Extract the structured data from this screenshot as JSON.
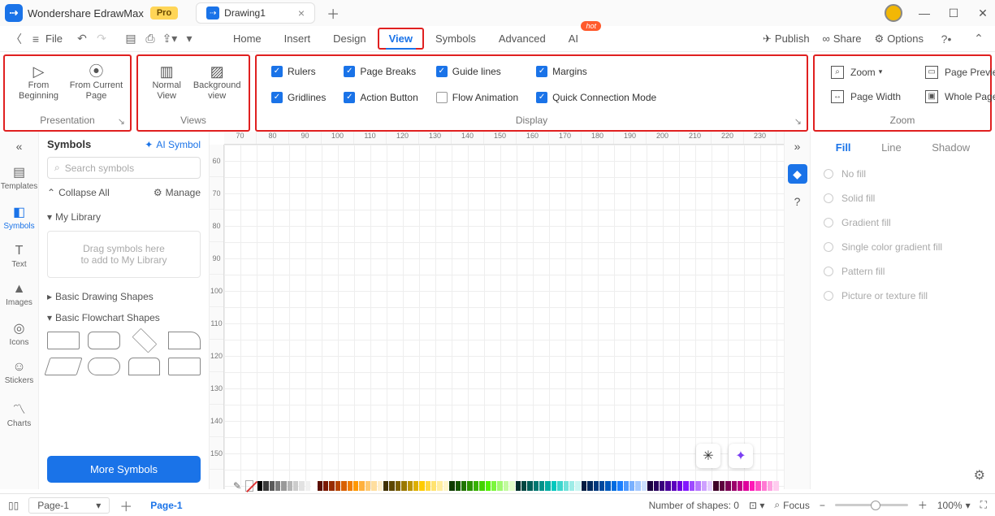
{
  "titlebar": {
    "app_name": "Wondershare EdrawMax",
    "pro": "Pro",
    "tab": "Drawing1"
  },
  "menubar": {
    "file": "File",
    "items": [
      "Home",
      "Insert",
      "Design",
      "View",
      "Symbols",
      "Advanced",
      "AI"
    ],
    "active": "View",
    "hot": "hot",
    "publish": "Publish",
    "share": "Share",
    "options": "Options"
  },
  "ribbon": {
    "presentation": {
      "label": "Presentation",
      "from_beginning": "From\nBeginning",
      "from_current": "From Current\nPage"
    },
    "views": {
      "label": "Views",
      "normal": "Normal\nView",
      "background": "Background\nview"
    },
    "display": {
      "label": "Display",
      "rulers": "Rulers",
      "page_breaks": "Page Breaks",
      "guide_lines": "Guide lines",
      "margins": "Margins",
      "gridlines": "Gridlines",
      "action_button": "Action Button",
      "flow_animation": "Flow Animation",
      "quick_conn": "Quick Connection Mode"
    },
    "zoom": {
      "label": "Zoom",
      "zoom": "Zoom",
      "page_preview": "Page Preview",
      "page_width": "Page Width",
      "whole_page": "Whole Page"
    }
  },
  "leftbar": {
    "templates": "Templates",
    "symbols": "Symbols",
    "text": "Text",
    "images": "Images",
    "icons": "Icons",
    "stickers": "Stickers",
    "charts": "Charts"
  },
  "symbols": {
    "title": "Symbols",
    "ai": "AI Symbol",
    "search_ph": "Search symbols",
    "collapse": "Collapse All",
    "manage": "Manage",
    "mylib": "My Library",
    "drop1": "Drag symbols here",
    "drop2": "to add to My Library",
    "basic_drawing": "Basic Drawing Shapes",
    "basic_flow": "Basic Flowchart Shapes",
    "more": "More Symbols"
  },
  "ruler_h": [
    "70",
    "80",
    "90",
    "100",
    "110",
    "120",
    "130",
    "140",
    "150",
    "160",
    "170",
    "180",
    "190",
    "200",
    "210",
    "220",
    "230"
  ],
  "ruler_v": [
    "60",
    "70",
    "80",
    "90",
    "100",
    "110",
    "120",
    "130",
    "140",
    "150"
  ],
  "rightpanel": {
    "tabs": [
      "Fill",
      "Line",
      "Shadow"
    ],
    "opts": [
      "No fill",
      "Solid fill",
      "Gradient fill",
      "Single color gradient fill",
      "Pattern fill",
      "Picture or texture fill"
    ]
  },
  "colors": [
    "#000",
    "#3b3b3b",
    "#5a5a5a",
    "#7a7a7a",
    "#999",
    "#b5b5b5",
    "#ccc",
    "#e2e2e2",
    "#f0f0f0",
    "#fff",
    "#5b0f00",
    "#7b1700",
    "#972b00",
    "#b84400",
    "#d96000",
    "#f07c00",
    "#ff9800",
    "#ffb13d",
    "#ffc970",
    "#ffde9e",
    "#ffeec9",
    "#403000",
    "#5c4600",
    "#7a5e00",
    "#9a7800",
    "#bb9300",
    "#ddaf00",
    "#ffcb00",
    "#ffd83d",
    "#ffe370",
    "#ffed9e",
    "#fff6c9",
    "#0d3b00",
    "#155700",
    "#1f7400",
    "#2a9200",
    "#36b100",
    "#43d100",
    "#51f200",
    "#7bf63d",
    "#a0f970",
    "#c2fb9e",
    "#e1fdc9",
    "#002f2b",
    "#004641",
    "#005e58",
    "#007770",
    "#009189",
    "#00aca3",
    "#00c8be",
    "#3dd6cd",
    "#70e2db",
    "#9eece7",
    "#c9f5f2",
    "#001b40",
    "#00295e",
    "#00387d",
    "#00489d",
    "#0059be",
    "#006be0",
    "#1a7eff",
    "#4d98ff",
    "#7ab1ff",
    "#a4c9ff",
    "#cce0ff",
    "#1a003f",
    "#28005d",
    "#38007c",
    "#49009c",
    "#5b00bd",
    "#6e00df",
    "#8316ff",
    "#9e4aff",
    "#b777ff",
    "#cea1ff",
    "#e5ccff",
    "#3f0029",
    "#5d003e",
    "#7c0054",
    "#9c006b",
    "#bd0083",
    "#df009c",
    "#ff18b6",
    "#ff4cc5",
    "#ff79d3",
    "#ffa2e1",
    "#ffccef"
  ],
  "status": {
    "page_sel": "Page-1",
    "page_tab": "Page-1",
    "shapes": "Number of shapes: 0",
    "focus": "Focus",
    "zoom": "100%"
  }
}
